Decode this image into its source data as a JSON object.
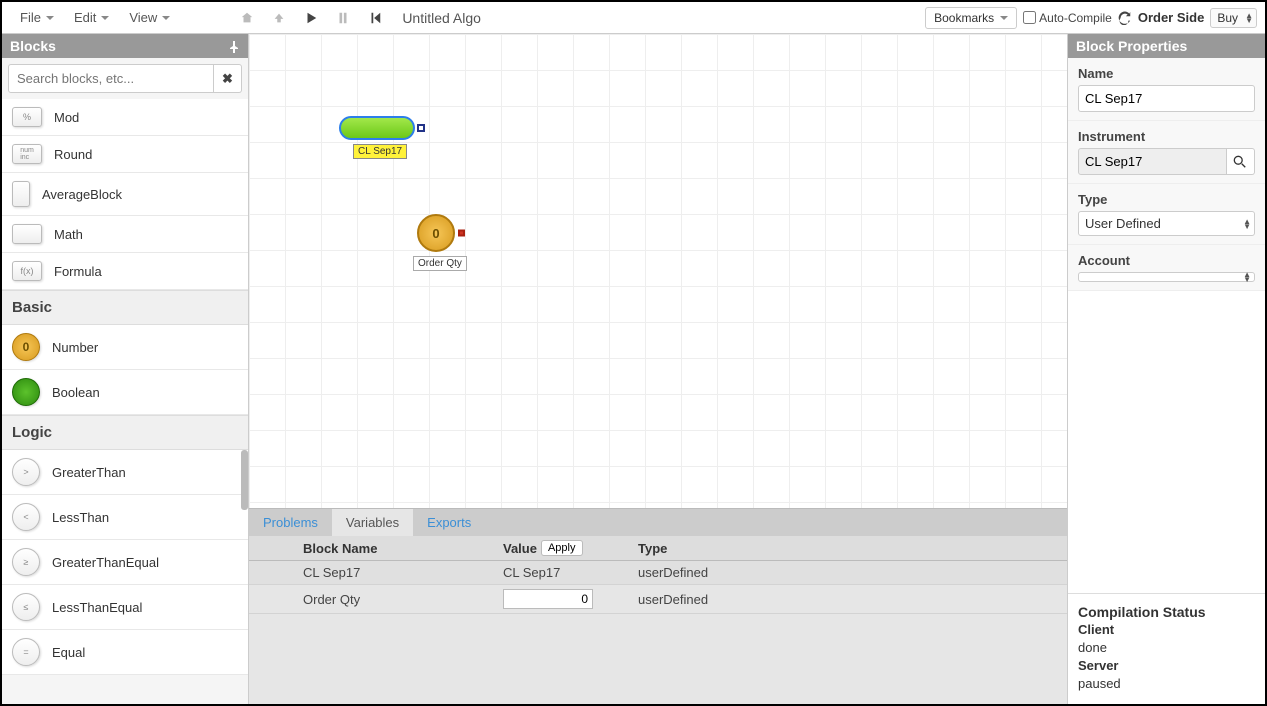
{
  "menus": {
    "file": "File",
    "edit": "Edit",
    "view": "View"
  },
  "title": "Untitled Algo",
  "toolbar_right": {
    "bookmarks": "Bookmarks",
    "auto_compile": "Auto-Compile",
    "order_side_label": "Order Side",
    "order_side_value": "Buy"
  },
  "blocks_panel": {
    "title": "Blocks",
    "search_placeholder": "Search blocks, etc...",
    "items_math": [
      "Mod",
      "Round",
      "AverageBlock",
      "Math",
      "Formula"
    ],
    "section_basic": "Basic",
    "items_basic": [
      "Number",
      "Boolean"
    ],
    "section_logic": "Logic",
    "items_logic": [
      "GreaterThan",
      "LessThan",
      "GreaterThanEqual",
      "LessThanEqual",
      "Equal"
    ]
  },
  "canvas": {
    "instr_label": "CL Sep17",
    "qty_value": "0",
    "qty_label": "Order Qty"
  },
  "bottom_tabs": {
    "problems": "Problems",
    "variables": "Variables",
    "exports": "Exports"
  },
  "var_table": {
    "headers": {
      "name": "Block Name",
      "value": "Value",
      "apply": "Apply",
      "type": "Type"
    },
    "rows": [
      {
        "name": "CL Sep17",
        "value": "CL Sep17",
        "type": "userDefined",
        "editable": false
      },
      {
        "name": "Order Qty",
        "value": "0",
        "type": "userDefined",
        "editable": true
      }
    ]
  },
  "props": {
    "title": "Block Properties",
    "name_label": "Name",
    "name_value": "CL Sep17",
    "instrument_label": "Instrument",
    "instrument_value": "CL Sep17",
    "type_label": "Type",
    "type_value": "User Defined",
    "account_label": "Account",
    "account_value": ""
  },
  "status": {
    "title": "Compilation Status",
    "client_label": "Client",
    "client_value": "done",
    "server_label": "Server",
    "server_value": "paused"
  }
}
